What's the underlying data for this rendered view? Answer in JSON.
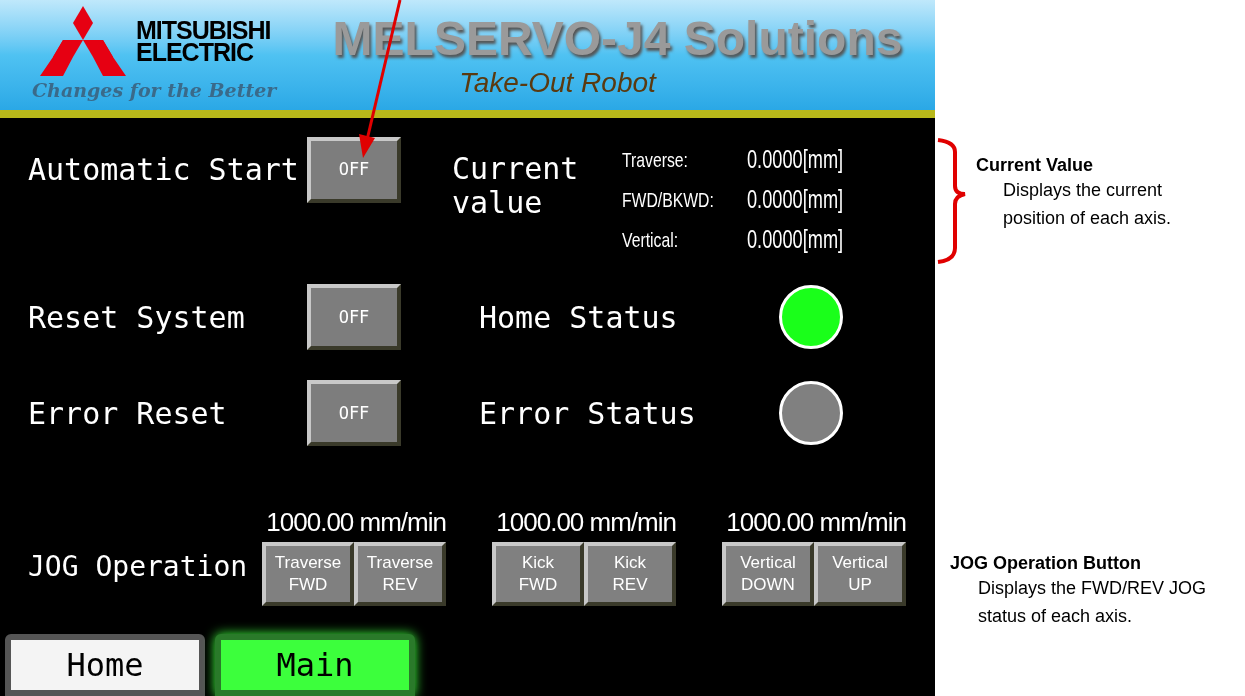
{
  "header": {
    "brand": [
      "MITSUBISHI",
      "ELECTRIC"
    ],
    "tagline": "Changes for the Better",
    "title": "MELSERVO-J4 Solutions",
    "subtitle": "Take-Out Robot"
  },
  "controls": [
    {
      "label": "Automatic Start",
      "button": "OFF"
    },
    {
      "label": "Reset System",
      "button": "OFF"
    },
    {
      "label": "Error Reset",
      "button": "OFF"
    }
  ],
  "current_value": {
    "label": "Current value",
    "readings": [
      {
        "name": "Traverse:",
        "value": "0.0000[mm]"
      },
      {
        "name": "FWD/BKWD:",
        "value": "0.0000[mm]"
      },
      {
        "name": "Vertical:",
        "value": "0.0000[mm]"
      }
    ]
  },
  "lamps": [
    {
      "label": "Home Status",
      "on": true
    },
    {
      "label": "Error Status",
      "on": false
    }
  ],
  "jog": {
    "label": "JOG Operation",
    "groups": [
      {
        "speed": "1000.00 mm/min",
        "buttons": [
          [
            "Traverse",
            "FWD"
          ],
          [
            "Traverse",
            "REV"
          ]
        ]
      },
      {
        "speed": "1000.00 mm/min",
        "buttons": [
          [
            "Kick",
            "FWD"
          ],
          [
            "Kick",
            "REV"
          ]
        ]
      },
      {
        "speed": "1000.00 mm/min",
        "buttons": [
          [
            "Vertical",
            "DOWN"
          ],
          [
            "Vertical",
            "UP"
          ]
        ]
      }
    ]
  },
  "nav": [
    {
      "label": "Home",
      "selected": false
    },
    {
      "label": "Main",
      "selected": true
    }
  ],
  "annotations": [
    {
      "kind": "brace",
      "title": "Current Value",
      "text": "Displays the current position of each axis."
    },
    {
      "kind": "plain",
      "title": "JOG Operation Button",
      "text": "Displays the FWD/REV JOG status of each axis."
    }
  ]
}
